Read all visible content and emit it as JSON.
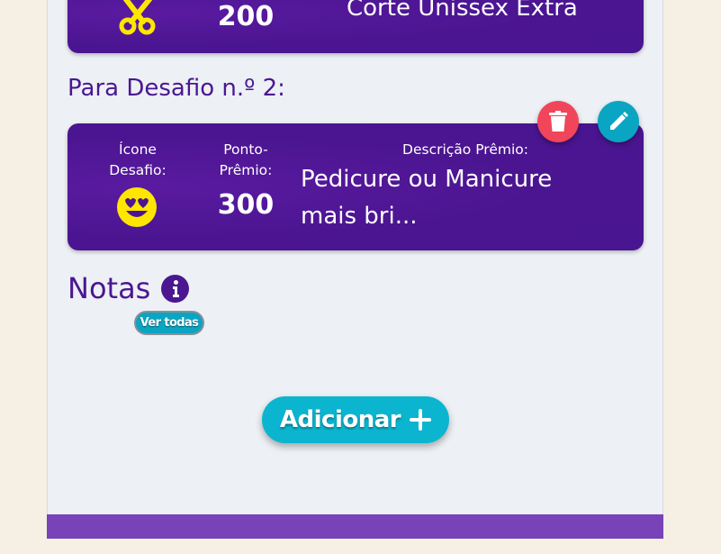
{
  "top_card": {
    "points": "200",
    "description": "Corte Unissex Extra",
    "icon": "scissors-icon"
  },
  "section2": {
    "title": "Para Desafio n.º 2:",
    "card": {
      "icon_label_line1": "Ícone",
      "icon_label_line2": "Desafio:",
      "points_label_line1": "Ponto-",
      "points_label_line2": "Prêmio:",
      "points": "300",
      "description_label": "Descrição Prêmio:",
      "description_line1": "Pedicure ou Manicure",
      "description_line2": "mais bri...",
      "icon": "smiling-face-heart-eyes-icon"
    },
    "delete_icon": "trash-icon",
    "edit_icon": "pencil-icon"
  },
  "notes": {
    "title": "Notas",
    "info_icon": "info-icon",
    "view_all_label": "Ver todas"
  },
  "add_button": {
    "label": "Adicionar",
    "icon": "plus-icon"
  },
  "colors": {
    "card_purple": "#4b1591",
    "title_purple": "#4a1791",
    "delete_red": "#f0455a",
    "edit_cyan": "#0aa5c3",
    "add_cyan": "#0bb5cf",
    "icon_yellow": "#ffe600",
    "footer_purple": "#7843b8",
    "page_background": "#f6efe3"
  }
}
